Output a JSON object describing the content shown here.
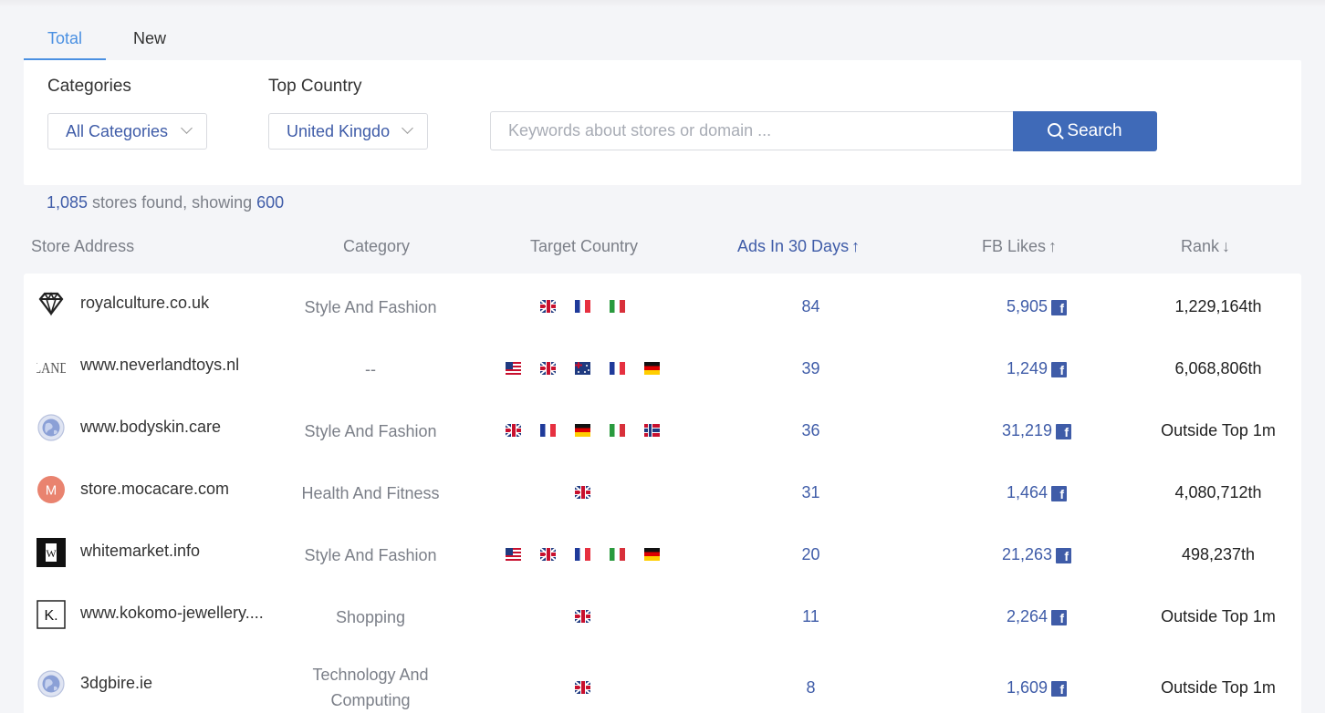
{
  "tabs": {
    "total_label": "Total",
    "new_label": "New",
    "help_glyph": "?"
  },
  "filters": {
    "categories_label": "Categories",
    "categories_value": "All Categories",
    "country_label": "Top Country",
    "country_value": "United Kingdo",
    "search_placeholder": "Keywords about stores or domain ...",
    "search_button": "Search"
  },
  "summary": {
    "found_count": "1,085",
    "found_text": " stores found, showing ",
    "showing_count": "600"
  },
  "table": {
    "headers": {
      "store": "Store Address",
      "category": "Category",
      "country": "Target Country",
      "ads": "Ads In 30 Days",
      "likes": "FB Likes",
      "rank": "Rank"
    },
    "sort_icons": {
      "ads": "↑",
      "likes": "↑",
      "rank": "↓"
    },
    "rows": [
      {
        "store": "royalculture.co.uk",
        "category": "Style And Fashion",
        "flags": [
          "uk",
          "fr",
          "it"
        ],
        "ads": "84",
        "likes": "5,905",
        "rank": "1,229,164th",
        "logo": "diamond-logo"
      },
      {
        "store": "www.neverlandtoys.nl",
        "category": "--",
        "flags": [
          "us",
          "uk",
          "au",
          "fr",
          "de"
        ],
        "ads": "39",
        "likes": "1,249",
        "rank": "6,068,806th",
        "logo": "land-logo"
      },
      {
        "store": "www.bodyskin.care",
        "category": "Style And Fashion",
        "flags": [
          "uk",
          "fr",
          "de",
          "it",
          "no"
        ],
        "ads": "36",
        "likes": "31,219",
        "rank": "Outside Top 1m",
        "logo": "globe-logo"
      },
      {
        "store": "store.mocacare.com",
        "category": "Health And Fitness",
        "flags": [
          "uk"
        ],
        "ads": "31",
        "likes": "1,464",
        "rank": "4,080,712th",
        "logo": "m-logo"
      },
      {
        "store": "whitemarket.info",
        "category": "Style And Fashion",
        "flags": [
          "us",
          "uk",
          "fr",
          "it",
          "de"
        ],
        "ads": "20",
        "likes": "21,263",
        "rank": "498,237th",
        "logo": "w-logo"
      },
      {
        "store": "www.kokomo-jewellery....",
        "category": "Shopping",
        "flags": [
          "uk"
        ],
        "ads": "11",
        "likes": "2,264",
        "rank": "Outside Top 1m",
        "logo": "k-logo"
      },
      {
        "store": "3dgbire.ie",
        "category": "Technology And Computing",
        "flags": [
          "uk"
        ],
        "ads": "8",
        "likes": "1,609",
        "rank": "Outside Top 1m",
        "logo": "globe-logo"
      }
    ]
  },
  "logo_text": {
    "m": "M",
    "w": "W",
    "k": "K.",
    "land": "LAND"
  },
  "fb_glyph": "f",
  "colors": {
    "accent": "#4a90e2",
    "brand": "#3f5ca8",
    "button": "#3f6ab8",
    "muted": "#7b7f88"
  }
}
